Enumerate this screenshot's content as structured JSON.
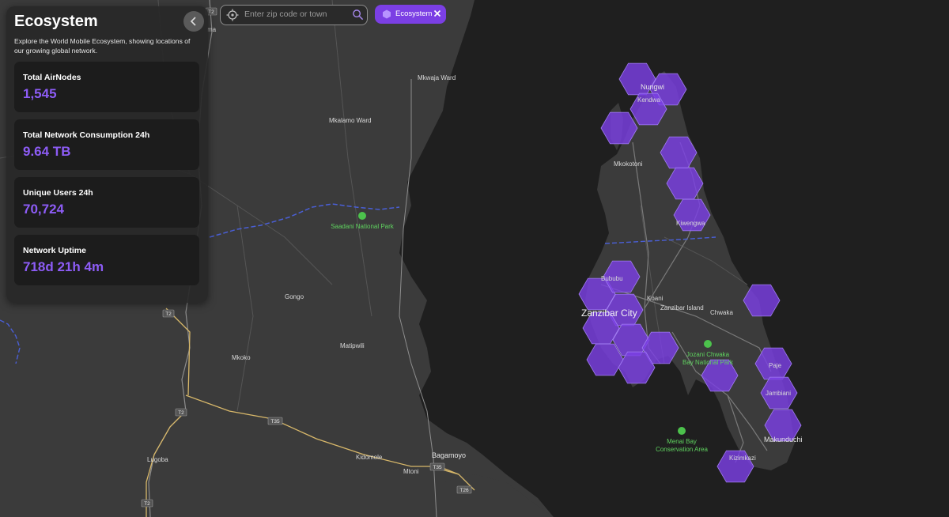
{
  "panel": {
    "title": "Ecosystem",
    "description": "Explore the World Mobile Ecosystem, showing locations of our growing global network.",
    "stats": [
      {
        "label": "Total AirNodes",
        "value": "1,545"
      },
      {
        "label": "Total Network Consumption 24h",
        "value": "9.64 TB"
      },
      {
        "label": "Unique Users 24h",
        "value": "70,724"
      },
      {
        "label": "Network Uptime",
        "value": "718d 21h 4m"
      }
    ]
  },
  "search": {
    "placeholder": "Enter zip code or town",
    "value": ""
  },
  "filter_chip": {
    "label": "Ecosystem"
  },
  "colors": {
    "accent": "#8d5cf6",
    "hex_fill": "#7b3fe4",
    "park": "#5fd35f",
    "land": "#3a3a3a",
    "sea": "#1e1e1e",
    "road": "#d8b86a",
    "border": "#4a5fd6"
  },
  "map": {
    "places": {
      "nungwi": "Nungwi",
      "kendwa": "Kendwa",
      "mkokotoni": "Mkokotoni",
      "kiwengwa": "Kiwengwa",
      "bububu": "Bububu",
      "koani": "Koani",
      "zanzibar_city": "Zanzibar City",
      "zanzibar_island": "Zanzibar Island",
      "chwaka": "Chwaka",
      "paje": "Paje",
      "jambiani": "Jambiani",
      "makunduchi": "Makunduchi",
      "kizimkazi": "Kizimkazi",
      "mkwaja_ward": "Mkwaja Ward",
      "mkalamo_ward": "Mkalamo Ward",
      "gongo": "Gongo",
      "matipwili": "Matipwili",
      "mkoko": "Mkoko",
      "lugoba": "Lugoba",
      "kidomole": "Kidomole",
      "mtoni": "Mtoni",
      "bagamoyo": "Bagamoyo",
      "ma": "ma"
    },
    "parks": {
      "saadani": "Saadani National Park",
      "jozani_1": "Jozani Chwaka",
      "jozani_2": "Bay National Park",
      "menai_1": "Menai Bay",
      "menai_2": "Conservation Area"
    },
    "shields": {
      "t2": "T2",
      "t35": "T35",
      "t26": "T26"
    }
  }
}
